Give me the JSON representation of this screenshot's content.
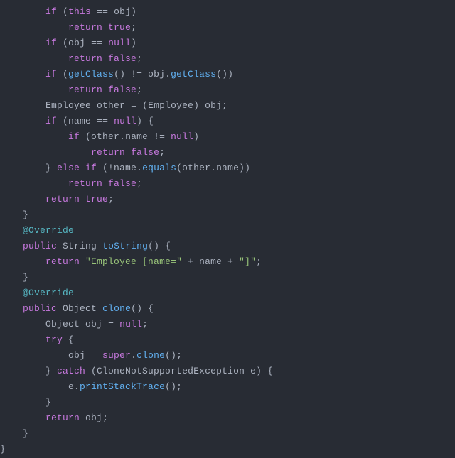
{
  "l1": {
    "k1": "if",
    "k2": "this",
    "id1": "obj"
  },
  "l2": {
    "k1": "return",
    "k2": "true"
  },
  "l3": {
    "k1": "if",
    "id1": "obj",
    "k2": "null"
  },
  "l4": {
    "k1": "return",
    "k2": "false"
  },
  "l5": {
    "k1": "if",
    "fn1": "getClass",
    "id1": "obj",
    "fn2": "getClass"
  },
  "l6": {
    "k1": "return",
    "k2": "false"
  },
  "l7": {
    "t1": "Employee",
    "id1": "other",
    "t2": "Employee",
    "id2": "obj"
  },
  "l8": {
    "k1": "if",
    "id1": "name",
    "k2": "null"
  },
  "l9": {
    "k1": "if",
    "id1": "other",
    "id2": "name",
    "k2": "null"
  },
  "l10": {
    "k1": "return",
    "k2": "false"
  },
  "l11": {
    "k1": "else if",
    "id1": "name",
    "fn1": "equals",
    "id2": "other",
    "id3": "name"
  },
  "l12": {
    "k1": "return",
    "k2": "false"
  },
  "l13": {
    "k1": "return",
    "k2": "true"
  },
  "l15": {
    "ann": "@Override"
  },
  "l16": {
    "k1": "public",
    "t1": "String",
    "fn1": "toString"
  },
  "l17": {
    "k1": "return",
    "s1": "\"Employee [name=\"",
    "id1": "name",
    "s2": "\"]\""
  },
  "l19": {
    "ann": "@Override"
  },
  "l20": {
    "k1": "public",
    "t1": "Object",
    "fn1": "clone"
  },
  "l21": {
    "t1": "Object",
    "id1": "obj",
    "k1": "null"
  },
  "l22": {
    "k1": "try"
  },
  "l23": {
    "id1": "obj",
    "k1": "super",
    "fn1": "clone"
  },
  "l24": {
    "k1": "catch",
    "t1": "CloneNotSupportedException",
    "id1": "e"
  },
  "l25": {
    "id1": "e",
    "fn1": "printStackTrace"
  },
  "l27": {
    "k1": "return",
    "id1": "obj"
  }
}
